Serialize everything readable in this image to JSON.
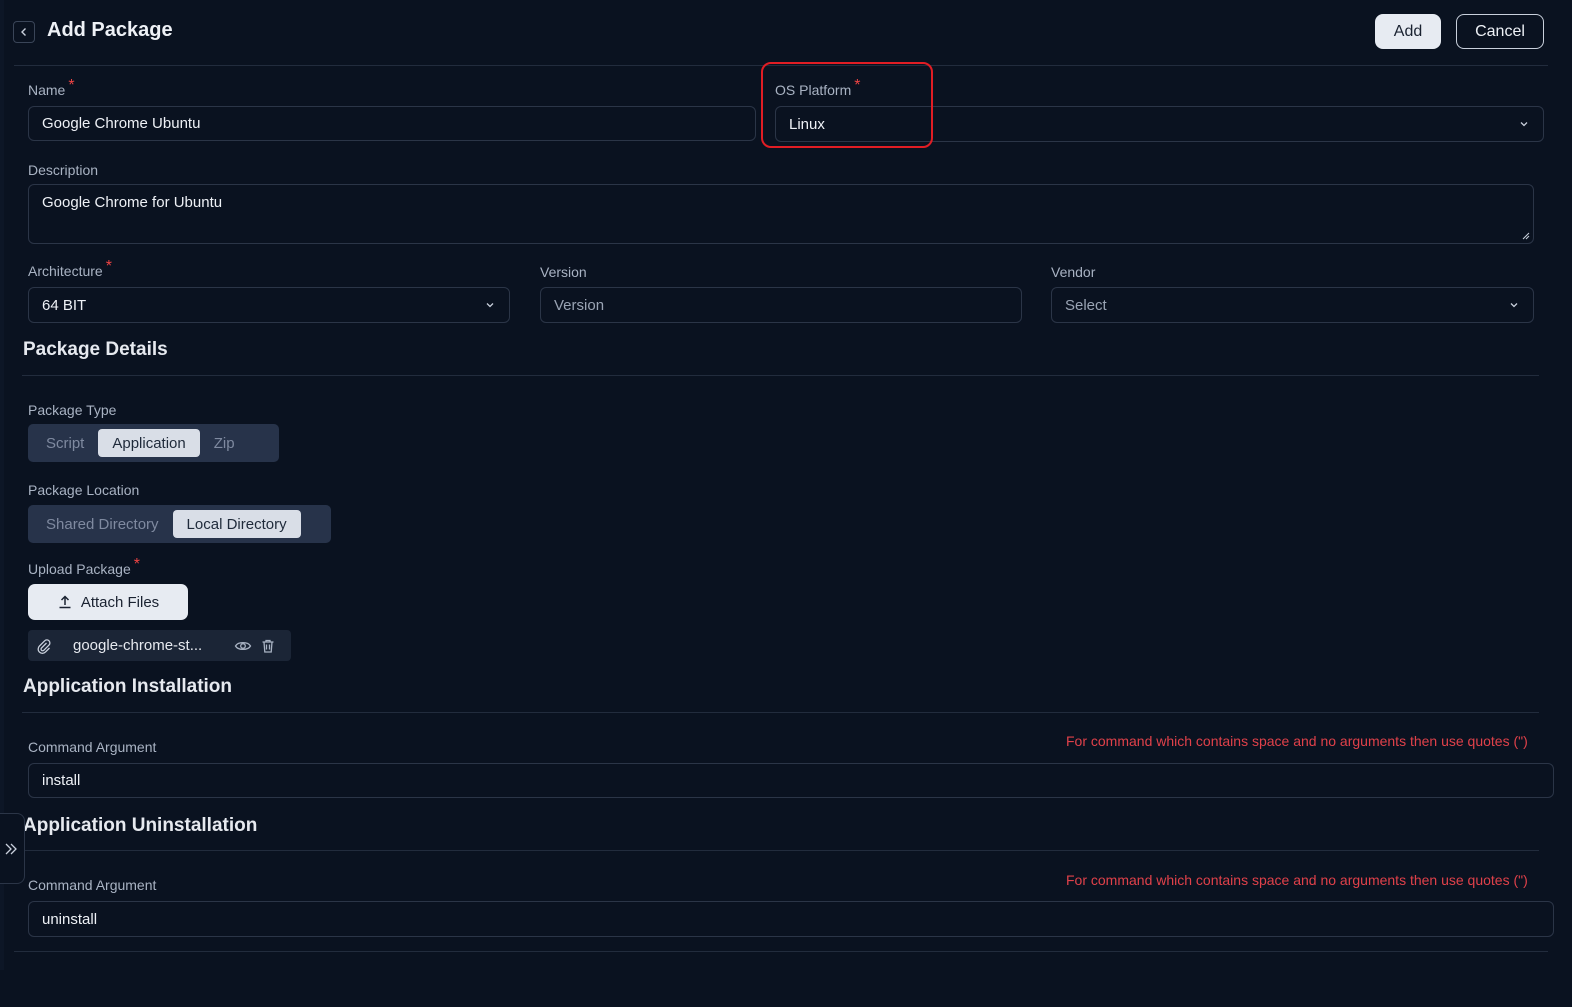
{
  "header": {
    "title": "Add Package",
    "add_label": "Add",
    "cancel_label": "Cancel"
  },
  "form": {
    "name_label": "Name",
    "name_value": "Google Chrome Ubuntu",
    "os_label": "OS Platform",
    "os_value": "Linux",
    "description_label": "Description",
    "description_value": "Google Chrome for Ubuntu",
    "architecture_label": "Architecture",
    "architecture_value": "64 BIT",
    "version_label": "Version",
    "version_placeholder": "Version",
    "vendor_label": "Vendor",
    "vendor_placeholder": "Select",
    "required_mark": "*"
  },
  "package_details": {
    "title": "Package Details",
    "type_label": "Package Type",
    "type_options": [
      "Script",
      "Application",
      "Zip"
    ],
    "type_selected": "Application",
    "location_label": "Package Location",
    "location_options": [
      "Shared Directory",
      "Local Directory"
    ],
    "location_selected": "Local Directory",
    "upload_label": "Upload Package",
    "attach_label": "Attach Files",
    "file_name": "google-chrome-st..."
  },
  "installation": {
    "title": "Application Installation",
    "command_label": "Command Argument",
    "hint": "For command which contains space and no arguments then use quotes (\")",
    "command_value": "install"
  },
  "uninstallation": {
    "title": "Application Uninstallation",
    "command_label": "Command Argument",
    "hint": "For command which contains space and no arguments then use quotes (\")",
    "command_value": "uninstall"
  },
  "icons": {
    "back": "chevron-left-icon",
    "dropdown": "chevron-down-icon",
    "upload": "upload-icon",
    "paperclip": "paperclip-icon",
    "view": "eye-icon",
    "delete": "trash-icon",
    "expand_sidebar": "double-chevron-right-icon"
  },
  "colors": {
    "background": "#0a1220",
    "accent_required": "#ef4444",
    "hint": "#e0414a",
    "highlight": "#e11d24"
  }
}
